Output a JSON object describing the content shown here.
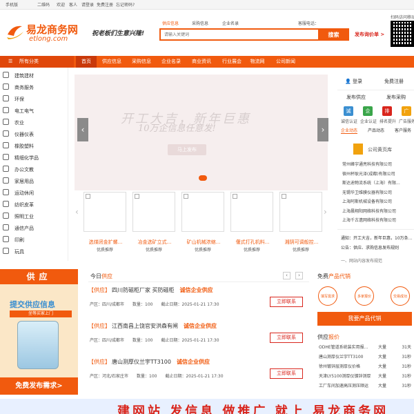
{
  "topbar": {
    "mobile": "手机版",
    "qrcode": "二维码",
    "welcome": "欢迎",
    "guest": "客人",
    "login": "请登录",
    "register": "免费注册",
    "forgot": "忘记密码?"
  },
  "header": {
    "logo_cn": "易龙商务网",
    "logo_en": "etlong.com",
    "slogan": "祝老板们生意兴隆!",
    "search_tabs": [
      "供应信息",
      "采购信息",
      "企业名录"
    ],
    "search_placeholder": "请输入关键词",
    "search_button": "搜索",
    "hotline_label": "客服电话：",
    "post_link": "发布询价单 >",
    "qr_label": "扫码访问移动"
  },
  "nav": {
    "all_categories": "所有分类",
    "items": [
      "首页",
      "供应信息",
      "采购信息",
      "企业名录",
      "商业资讯",
      "行业展会",
      "物流网",
      "公司新闻"
    ]
  },
  "sidebar": {
    "items": [
      "建筑建材",
      "商务服务",
      "环保",
      "电工电气",
      "农业",
      "仪器仪表",
      "橡胶塑料",
      "精细化学品",
      "办公文教",
      "家居用品",
      "运动休闲",
      "纺织皮革",
      "照明工业",
      "通信产品",
      "印刷",
      "玩具"
    ]
  },
  "banner": {
    "line1": "开工大吉，新年巨惠",
    "line2": "10万企信息任意发!",
    "button": "马上发布"
  },
  "products": [
    {
      "name": "选煤闭金扩螺...",
      "sub": "优质推荐"
    },
    {
      "name": "冶金选矿立式...",
      "sub": "优质推荐"
    },
    {
      "name": "矿山机械浓缩...",
      "sub": "优质推荐"
    },
    {
      "name": "偃式打孔机料...",
      "sub": "优质推荐"
    },
    {
      "name": "湘阴可调般控...",
      "sub": "优质推荐"
    }
  ],
  "right": {
    "login": "登录",
    "register": "免费注册",
    "post_supply": "发布供应",
    "post_purchase": "发布采购",
    "badges": [
      {
        "icon": "诚",
        "label": "诚信认证",
        "color": "#3b8fd1"
      },
      {
        "icon": "企",
        "label": "企业认证",
        "color": "#3aa54a"
      },
      {
        "icon": "排",
        "label": "排名提升",
        "color": "#d9251c"
      },
      {
        "icon": "广",
        "label": "广告服务",
        "color": "#f1a20e"
      }
    ],
    "tabs": [
      "企业动态",
      "产品动态",
      "客户服务"
    ],
    "company_title": "公司黄页库",
    "companies": [
      "常州峰宇通亮科技有限公司",
      "宿州杯耿光泽(成都)有限公司",
      "斯达迪物流系统（上海）有限...",
      "无锡华卫维膜仪器有限公司",
      "上海阿斯机械设备有限公司",
      "上海晨翔阳网络科技有限公司",
      "上海千古遗网络科技有限公司"
    ],
    "notice1": "通知：开工大吉，新年巨惠，10万条...",
    "notice2": "公告：供应、求购信息发布规则",
    "notice3": "一、网站内容发布规范"
  },
  "supply_ad": {
    "tag": "供应",
    "big": "提交供应信息",
    "strip": "坐等买家上门",
    "free": "免费发布需求>"
  },
  "today": {
    "title_prefix": "今日",
    "title_highlight": "供应",
    "rows": [
      {
        "tag": "【供应】",
        "title": "四川防磁柜厂家 买防磁柜",
        "badge": "诚信企业供应",
        "area": "产区：四川/成都市",
        "qty": "数量：100",
        "date": "截止日期：2025-01-21 17:30",
        "contact": "立即联系"
      },
      {
        "tag": "【供应】",
        "title": "江西南昌上饶官安洪森有闸",
        "badge": "诚信企业供应",
        "area": "产区：四川/成都市",
        "qty": "数量：100",
        "date": "截止日期：2025-01-21 17:30",
        "contact": "立即联系"
      },
      {
        "tag": "【供应】",
        "title": "唐山测厚仪兰宇TT3100",
        "badge": "诚信企业供应",
        "area": "产区：河北/石家庄市",
        "qty": "数量：100",
        "date": "截止日期：2025-01-21 17:30",
        "contact": "立即联系"
      }
    ]
  },
  "free": {
    "title_prefix": "免费",
    "title_highlight": "产品代销",
    "circles": [
      "填写需求",
      "多家报价",
      "交易成功"
    ],
    "button": "我要产品代销"
  },
  "quotes": {
    "title_prefix": "供应",
    "title_highlight": "报价",
    "rows": [
      {
        "name": "ODHE管道系统装实用报...",
        "qty": "大量",
        "days": "31天"
      },
      {
        "name": "唐山测厚仪兰宇TT3100",
        "qty": "大量",
        "days": "31秒"
      },
      {
        "name": "徐州镀锌层测厚仪价格",
        "qty": "大量",
        "days": "31秒"
      },
      {
        "name": "天津LY5100测厚仪镀锌测厚",
        "qty": "大量",
        "days": "31秒"
      },
      {
        "name": "工厂车间加速高压测压顺运",
        "qty": "大量",
        "days": "31秒"
      }
    ]
  },
  "bottom_banner": "建网站 发信息 做推广 就上 易龙商务网"
}
